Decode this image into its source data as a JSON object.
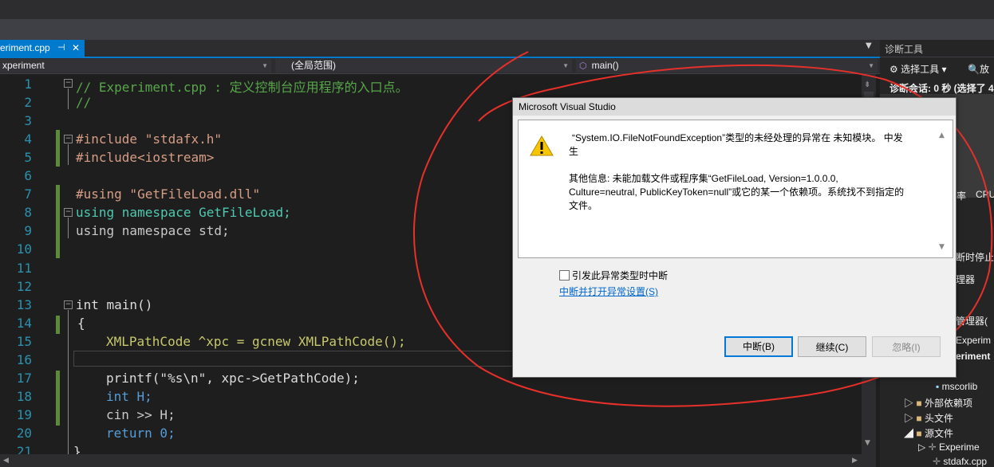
{
  "editor_tab": {
    "filename": "eriment.cpp",
    "pin": "⊣",
    "close": "✕"
  },
  "navbar": {
    "project": "xperiment",
    "scope": "(全局范围)",
    "function": "main()"
  },
  "code_lines": [
    {
      "n": "1",
      "text": "// Experiment.cpp : 定义控制台应用程序的入口点。"
    },
    {
      "n": "2",
      "text": "//"
    },
    {
      "n": "3",
      "text": ""
    },
    {
      "n": "4",
      "text": "#include \"stdafx.h\""
    },
    {
      "n": "5",
      "text": "#include<iostream>"
    },
    {
      "n": "6",
      "text": ""
    },
    {
      "n": "7",
      "text": "#using \"GetFileLoad.dll\""
    },
    {
      "n": "8",
      "text": "using namespace GetFileLoad;"
    },
    {
      "n": "9",
      "text": "using namespace std;"
    },
    {
      "n": "10",
      "text": ""
    },
    {
      "n": "11",
      "text": ""
    },
    {
      "n": "12",
      "text": ""
    },
    {
      "n": "13",
      "text": "int main()"
    },
    {
      "n": "14",
      "text": "{"
    },
    {
      "n": "15",
      "text": "XMLPathCode ^xpc = gcnew XMLPathCode();"
    },
    {
      "n": "16",
      "text": ""
    },
    {
      "n": "17",
      "text": "printf(\"%s\\n\", xpc->GetPathCode);"
    },
    {
      "n": "18",
      "text": "int H;"
    },
    {
      "n": "19",
      "text": "cin >> H;"
    },
    {
      "n": "20",
      "text": "return 0;"
    },
    {
      "n": "21",
      "text": "}"
    }
  ],
  "right_panel": {
    "title": "诊断工具",
    "select_tools": "选择工具",
    "zoom": "放",
    "session": "诊断会话: 0 秒 (选择了 4",
    "rate": "率",
    "cpu": "CPU",
    "stop": "断时停止",
    "manager": "理器",
    "manager2": "管理器(",
    "experiment": "Experim",
    "experiment2": "eriment",
    "tree": [
      "mscorlib",
      "外部依赖项",
      "头文件",
      "源文件",
      "Experime",
      "stdafx.cpp"
    ]
  },
  "dialog": {
    "title": "Microsoft Visual Studio",
    "message_line1": "“System.IO.FileNotFoundException”类型的未经处理的异常在 未知模块。 中发",
    "message_line2": "生",
    "info_line1": "其他信息: 未能加载文件或程序集“GetFileLoad, Version=1.0.0.0,",
    "info_line2": "Culture=neutral, PublicKeyToken=null”或它的某一个依赖项。系统找不到指定的",
    "info_line3": "文件。",
    "checkbox_label": "引发此异常类型时中断",
    "link": "中断并打开异常设置(S)",
    "btn_break": "中断(B)",
    "btn_continue": "继续(C)",
    "btn_ignore": "忽略(I)"
  },
  "colors": {
    "accent": "#007acc",
    "annotation": "#e8302a",
    "comment": "#57a64a",
    "keyword": "#569cd6"
  }
}
